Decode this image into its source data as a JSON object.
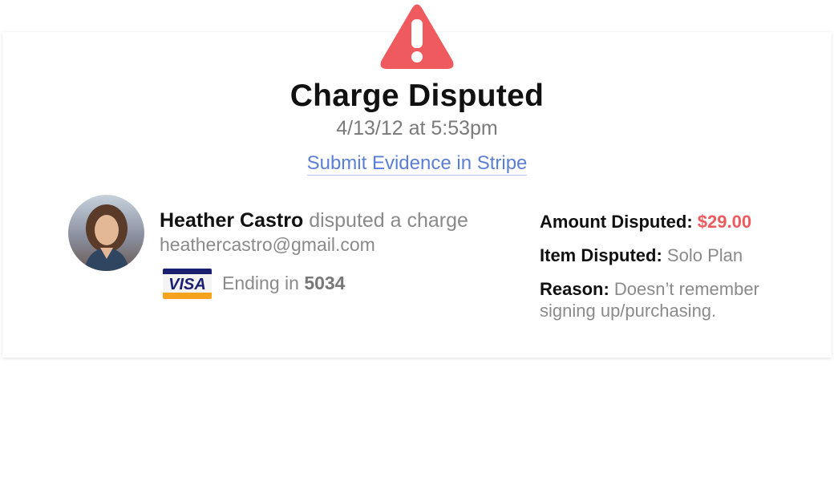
{
  "header": {
    "title": "Charge Disputed",
    "datetime": "4/13/12 at 5:53pm",
    "evidence_link": "Submit Evidence in Stripe",
    "alert_icon": "warning-triangle-icon",
    "alert_color": "#ee5a5d"
  },
  "customer": {
    "name": "Heather Castro",
    "action": "disputed a charge",
    "email": "heathercastro@gmail.com",
    "card_brand": "VISA",
    "card_ending_label": "Ending in",
    "card_last4": "5034"
  },
  "details": {
    "amount_label": "Amount Disputed:",
    "amount_value": "$29.00",
    "item_label": "Item Disputed:",
    "item_value": "Solo Plan",
    "reason_label": "Reason:",
    "reason_value": "Doesn’t remember signing up/purchasing."
  },
  "colors": {
    "accent_red": "#ee5a5d",
    "link_blue": "#5b7fd6",
    "visa_blue": "#1a1f71",
    "visa_orange": "#f7a21c"
  }
}
